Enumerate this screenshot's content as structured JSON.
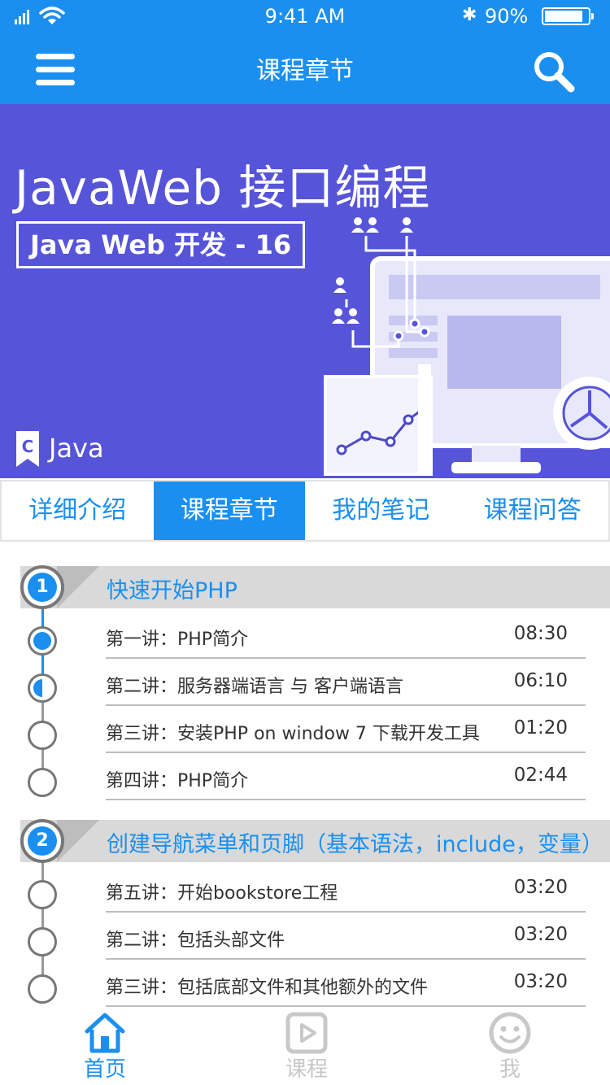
{
  "status_bar": {
    "time": "9:41 AM",
    "battery": "90%",
    "battery_level": 0.9
  },
  "header": {
    "title": "课程章节",
    "menu_icon": "menu-icon",
    "search_icon": "search-icon"
  },
  "banner": {
    "title": "JavaWeb 接口编程",
    "badge": "Java Web 开发 - 16",
    "brand": "Java",
    "colors": {
      "background": "#5654d8"
    }
  },
  "tabs": [
    {
      "label": "详细介绍",
      "active": false
    },
    {
      "label": "课程章节",
      "active": true
    },
    {
      "label": "我的笔记",
      "active": false
    },
    {
      "label": "课程问答",
      "active": false
    }
  ],
  "sections": [
    {
      "number": "1",
      "title": "快速开始PHP",
      "lessons": [
        {
          "name": "第一讲：PHP简介",
          "duration": "08:30",
          "state": "current"
        },
        {
          "name": "第二讲：服务器端语言 与 客户端语言",
          "duration": "06:10",
          "state": "partial"
        },
        {
          "name": "第三讲：安装PHP on window 7 下载开发工具",
          "duration": "01:20",
          "state": "none"
        },
        {
          "name": "第四讲：PHP简介",
          "duration": "02:44",
          "state": "none"
        }
      ]
    },
    {
      "number": "2",
      "title": "创建导航菜单和页脚（基本语法，include，变量）",
      "lessons": [
        {
          "name": "第五讲：开始bookstore工程",
          "duration": "03:20",
          "state": "none"
        },
        {
          "name": "第二讲：包括头部文件",
          "duration": "03:20",
          "state": "none"
        },
        {
          "name": "第三讲：包括底部文件和其他额外的文件",
          "duration": "03:20",
          "state": "none"
        }
      ]
    }
  ],
  "bottom_nav": [
    {
      "label": "首页",
      "icon": "home-icon",
      "active": true
    },
    {
      "label": "课程",
      "icon": "play-icon",
      "active": false
    },
    {
      "label": "我",
      "icon": "smiley-icon",
      "active": false
    }
  ],
  "colors": {
    "accent": "#1a8ff0",
    "inactive": "#c8c8c8",
    "section_bg": "#d9d9d9"
  }
}
